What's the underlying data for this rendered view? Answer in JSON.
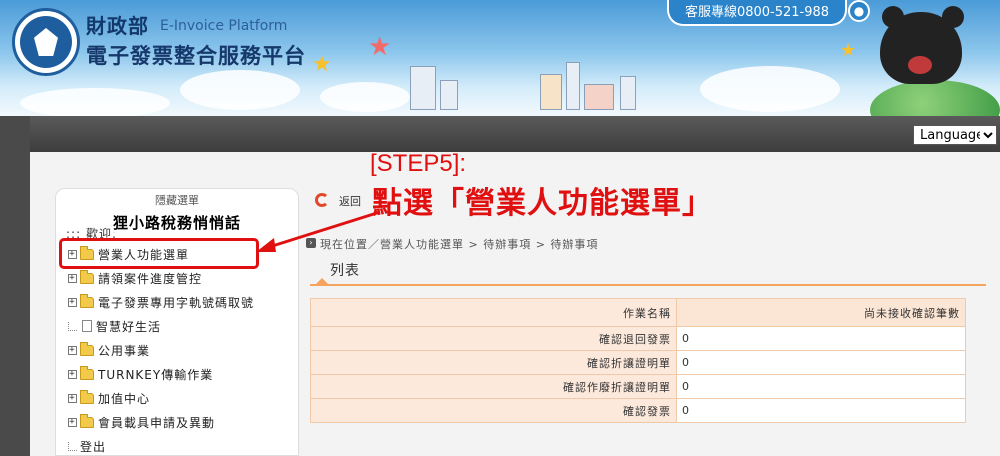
{
  "header": {
    "ministry": "財政部",
    "platform_en": "E-Invoice Platform",
    "platform_zh": "電子發票整合服務平台",
    "hotline": "客服專線0800-521-988",
    "pin_icon": "location-pin-icon"
  },
  "language_select": {
    "selected": "Language",
    "options": [
      "Language"
    ]
  },
  "sidebar": {
    "hide_label": "隱藏選單",
    "welcome": "::: 歡迎:",
    "items": [
      {
        "label": "營業人功能選單",
        "icon": "folder-icon",
        "expander": "⊞"
      },
      {
        "label": "請領案件進度管控",
        "icon": "folder-icon",
        "expander": "⊞"
      },
      {
        "label": "電子發票專用字軌號碼取號",
        "icon": "folder-icon",
        "expander": "⊞"
      },
      {
        "label": "智慧好生活",
        "icon": "document-icon",
        "expander": ""
      },
      {
        "label": "公用事業",
        "icon": "folder-icon",
        "expander": "⊞"
      },
      {
        "label": "TURNKEY傳輸作業",
        "icon": "folder-icon",
        "expander": "⊞"
      },
      {
        "label": "加值中心",
        "icon": "folder-icon",
        "expander": "⊞"
      },
      {
        "label": "會員載具申請及異動",
        "icon": "folder-icon",
        "expander": "⊞"
      },
      {
        "label": "登出",
        "icon": "",
        "expander": ""
      }
    ]
  },
  "main": {
    "back_label": "返回",
    "breadcrumb": "現在位置／營業人功能選單 > 待辦事項 > 待辦事項",
    "list_title": "列表",
    "table": {
      "headers": [
        "作業名稱",
        "尚未接收確認筆數"
      ],
      "rows": [
        {
          "name": "確認退回發票",
          "count": "0"
        },
        {
          "name": "確認折讓證明單",
          "count": "0"
        },
        {
          "name": "確認作廢折讓證明單",
          "count": "0"
        },
        {
          "name": "確認發票",
          "count": "0"
        }
      ]
    }
  },
  "annotation": {
    "step": "[STEP5]:",
    "description": "點選「營業人功能選單」",
    "hint": "狸小路稅務悄悄話",
    "color": "#e01010"
  }
}
